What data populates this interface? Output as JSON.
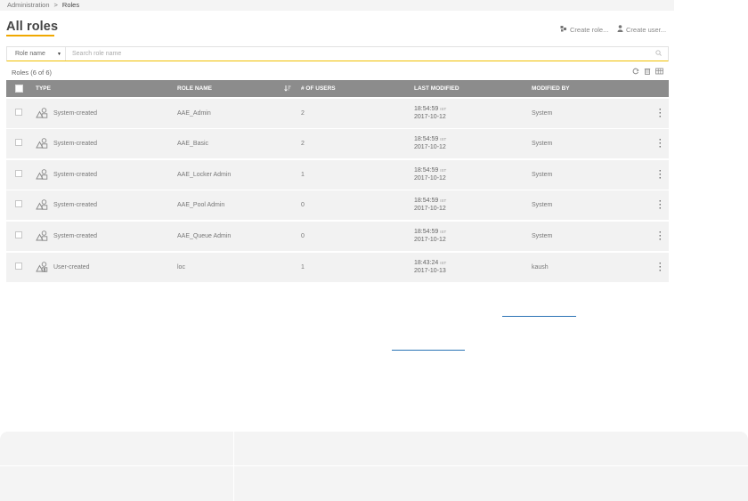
{
  "breadcrumb": {
    "parent": "Administration",
    "separator": ">",
    "current": "Roles"
  },
  "page": {
    "title": "All roles"
  },
  "actions": {
    "create_role": "Create role...",
    "create_user": "Create user..."
  },
  "filter": {
    "field": "Role name",
    "placeholder": "Search role name"
  },
  "list": {
    "count_label": "Roles (6 of 6)"
  },
  "table": {
    "columns": {
      "type": "TYPE",
      "role_name": "ROLE NAME",
      "users": "# OF USERS",
      "last_modified": "LAST MODIFIED",
      "modified_by": "MODIFIED BY"
    },
    "rows": [
      {
        "type": "System-created",
        "name": "AAE_Admin",
        "users": "2",
        "time": "18:54:59",
        "tz": "IST",
        "date": "2017-10-12",
        "by": "System"
      },
      {
        "type": "System-created",
        "name": "AAE_Basic",
        "users": "2",
        "time": "18:54:59",
        "tz": "IST",
        "date": "2017-10-12",
        "by": "System"
      },
      {
        "type": "System-created",
        "name": "AAE_Locker Admin",
        "users": "1",
        "time": "18:54:59",
        "tz": "IST",
        "date": "2017-10-12",
        "by": "System"
      },
      {
        "type": "System-created",
        "name": "AAE_Pool Admin",
        "users": "0",
        "time": "18:54:59",
        "tz": "IST",
        "date": "2017-10-12",
        "by": "System"
      },
      {
        "type": "System-created",
        "name": "AAE_Queue Admin",
        "users": "0",
        "time": "18:54:59",
        "tz": "IST",
        "date": "2017-10-12",
        "by": "System"
      },
      {
        "type": "User-created",
        "name": "loc",
        "users": "1",
        "time": "18:43:24",
        "tz": "IST",
        "date": "2017-10-13",
        "by": "kaush"
      }
    ]
  },
  "colors": {
    "accent": "#f0a800",
    "header": "#8c8c8c",
    "row": "#f2f2f2",
    "link": "#2a73b5"
  },
  "icons": [
    "cube-icon",
    "person-icon",
    "search-icon",
    "refresh-icon",
    "trash-icon",
    "columns-icon",
    "sort-icon",
    "role-icon",
    "user-role-icon",
    "kebab-menu-icon"
  ]
}
